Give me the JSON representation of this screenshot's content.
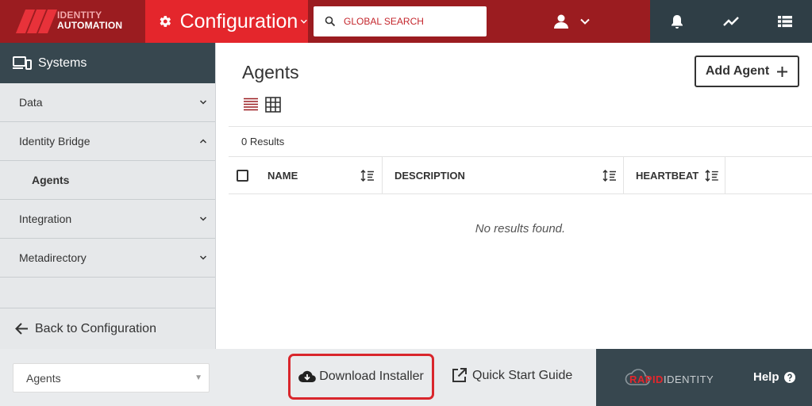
{
  "header": {
    "logo": {
      "line1": "IDENTITY",
      "line2": "AUTOMATION"
    },
    "module_title": "Configuration",
    "search_placeholder": "GLOBAL SEARCH",
    "icons": {
      "module": "gear-icon",
      "user": "user-icon",
      "notifications": "bell-icon",
      "activity": "trend-icon",
      "apps": "list-icon"
    }
  },
  "sidebar": {
    "title": "Systems",
    "items": [
      {
        "label": "Data",
        "state": "collapsed"
      },
      {
        "label": "Identity Bridge",
        "state": "expanded"
      },
      {
        "label": "Agents",
        "state": "selected-subitem"
      },
      {
        "label": "Integration",
        "state": "collapsed"
      },
      {
        "label": "Metadirectory",
        "state": "collapsed"
      }
    ],
    "back_label": "Back to Configuration"
  },
  "main": {
    "title": "Agents",
    "add_button": "Add Agent",
    "results": "0 Results",
    "columns": [
      "NAME",
      "DESCRIPTION",
      "HEARTBEAT"
    ],
    "empty_message": "No results found."
  },
  "footer": {
    "select_value": "Agents",
    "download_label": "Download Installer",
    "quickstart_label": "Quick Start Guide",
    "brand": {
      "rapid": "RAPID",
      "identity": "IDENTITY"
    },
    "help_label": "Help"
  },
  "colors": {
    "brand_red": "#e4262c",
    "header_dark_red": "#9b1c20",
    "slate": "#37474f",
    "highlight_border": "#d9262c"
  }
}
